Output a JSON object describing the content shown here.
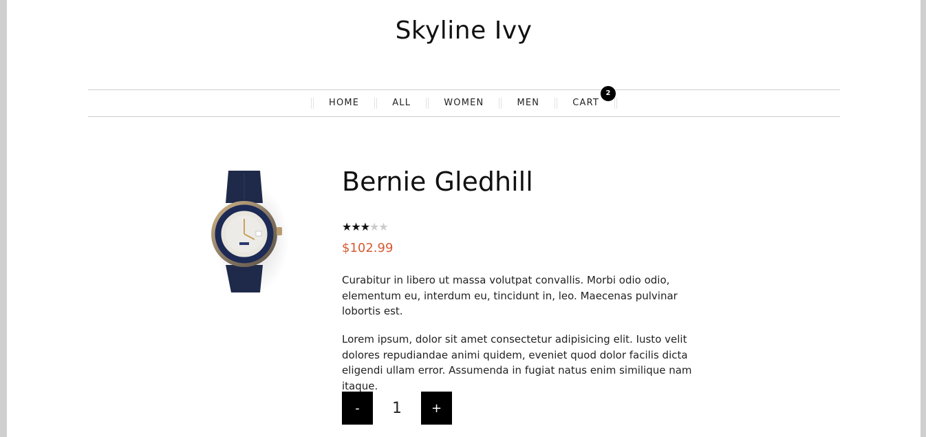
{
  "site": {
    "title": "Skyline Ivy"
  },
  "nav": {
    "items": [
      {
        "label": "HOME"
      },
      {
        "label": "ALL"
      },
      {
        "label": "WOMEN"
      },
      {
        "label": "MEN"
      },
      {
        "label": "CART"
      }
    ],
    "cart_count": "2"
  },
  "product": {
    "name": "Bernie Gledhill",
    "rating": 3,
    "rating_max": 5,
    "price": "$102.99",
    "description": [
      "Curabitur in libero ut massa volutpat convallis. Morbi odio odio, elementum eu, interdum eu, tincidunt in, leo. Maecenas pulvinar lobortis est.",
      "Lorem ipsum, dolor sit amet consectetur adipisicing elit. Iusto velit dolores repudiandae animi quidem, eveniet quod dolor facilis dicta eligendi ullam error. Assumenda in fugiat natus enim similique nam itaque."
    ],
    "image_icon": "wristwatch-icon"
  },
  "quantity": {
    "minus_label": "-",
    "value": "1",
    "plus_label": "+"
  },
  "colors": {
    "price": "#d65a31",
    "button_bg": "#000000",
    "badge_bg": "#000000"
  }
}
